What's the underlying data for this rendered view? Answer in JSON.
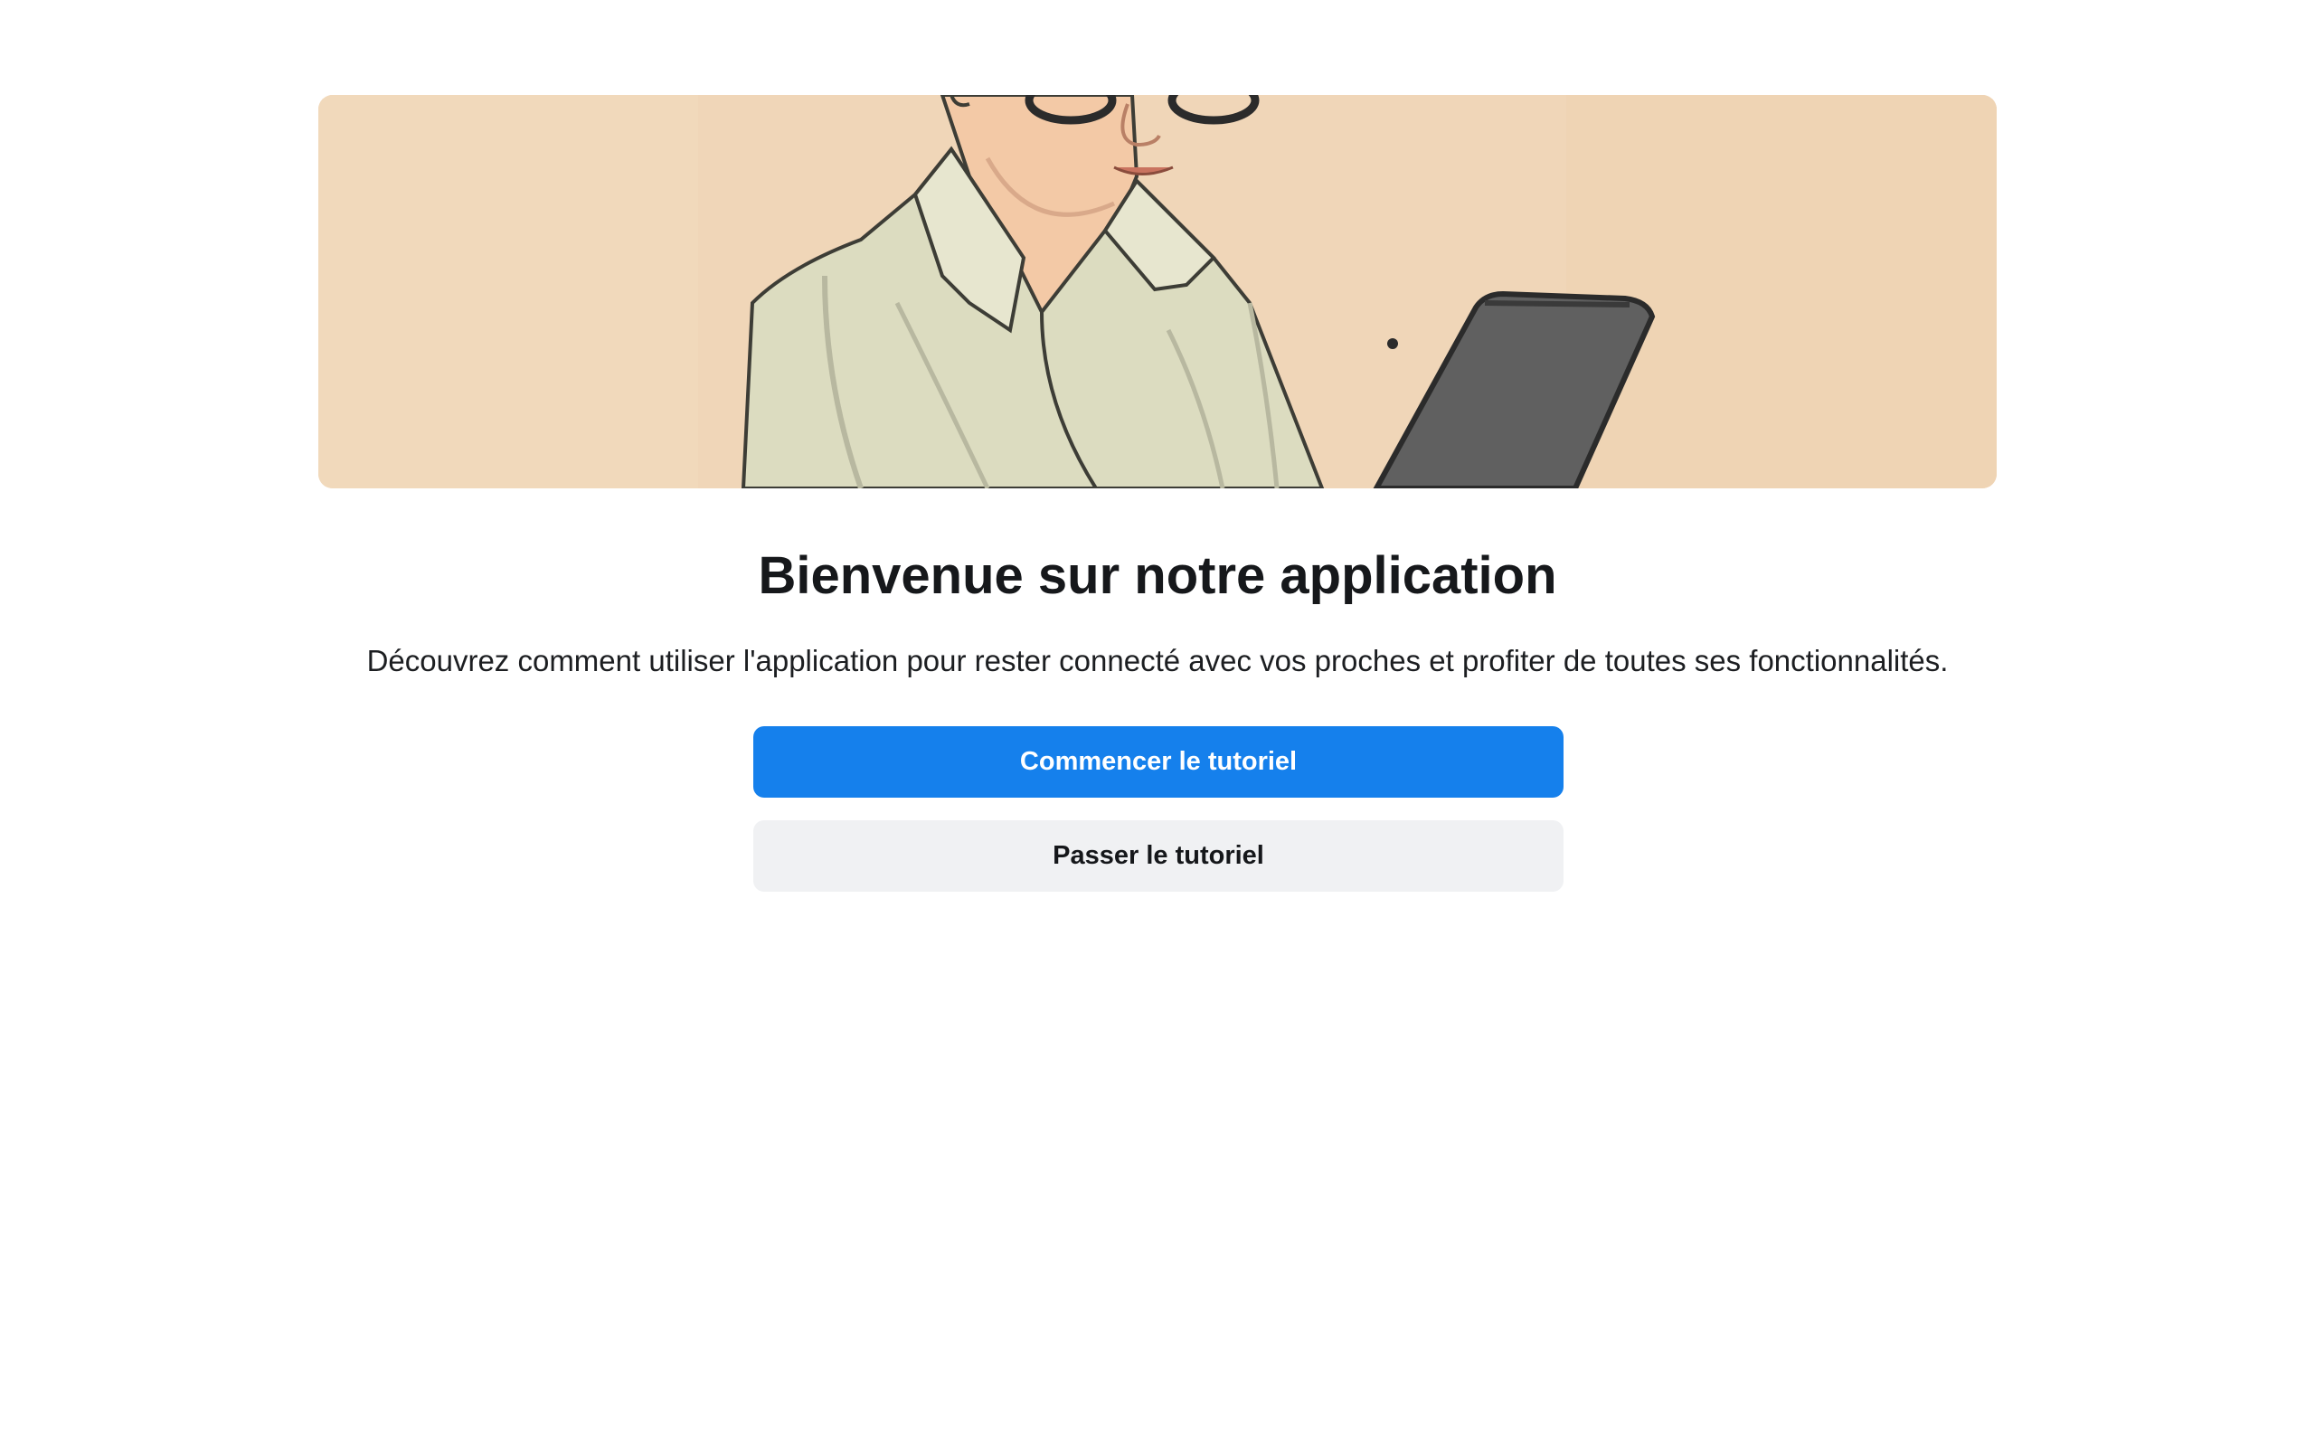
{
  "welcome": {
    "title": "Bienvenue sur notre application",
    "description": "Découvrez comment utiliser l'application pour rester connecté avec vos proches et profiter de toutes ses fonctionnalités.",
    "start_label": "Commencer le tutoriel",
    "skip_label": "Passer le tutoriel"
  },
  "hero": {
    "illustration": "senior-woman-using-tablet"
  },
  "colors": {
    "primary": "#1580ec",
    "secondary_bg": "#f0f1f3",
    "hero_bg": "#f0d6b6"
  }
}
